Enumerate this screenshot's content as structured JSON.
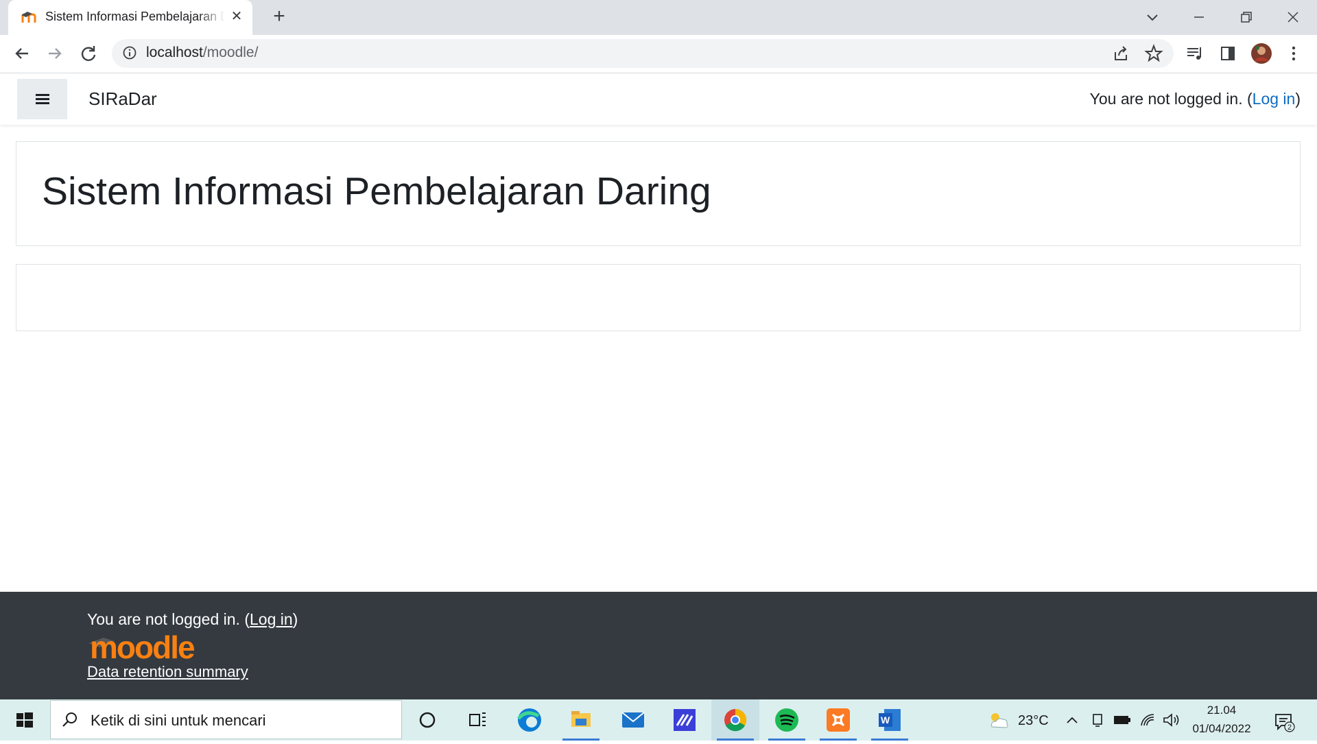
{
  "browser": {
    "tab_title": "Sistem Informasi Pembelajaran Daring",
    "url_host": "localhost",
    "url_path": "/moodle/",
    "icons": [
      "back-icon",
      "forward-icon",
      "reload-icon",
      "info-icon",
      "share-icon",
      "star-icon",
      "media-icon",
      "sidepanel-icon",
      "profile-avatar",
      "kebab-menu-icon"
    ]
  },
  "navbar": {
    "site_name": "SIRaDar",
    "login_prefix": "You are not logged in. (",
    "login_link": "Log in",
    "login_suffix": ")"
  },
  "page": {
    "heading": "Sistem Informasi Pembelajaran Daring"
  },
  "footer": {
    "login_prefix": "You are not logged in. (",
    "login_link": "Log in",
    "login_suffix": ")",
    "logo_text": "moodle",
    "data_retention": "Data retention summary"
  },
  "taskbar": {
    "search_placeholder": "Ketik di sini untuk mencari",
    "temperature": "23°C",
    "time": "21.04",
    "date": "01/04/2022",
    "notification_count": "2",
    "apps": [
      "cortana",
      "task-view",
      "edge",
      "file-explorer",
      "mail",
      "app",
      "chrome",
      "spotify",
      "xampp",
      "word"
    ]
  },
  "colors": {
    "link": "#0f6cbf",
    "footer_bg": "#343a40",
    "moodle_orange": "#f98012"
  }
}
